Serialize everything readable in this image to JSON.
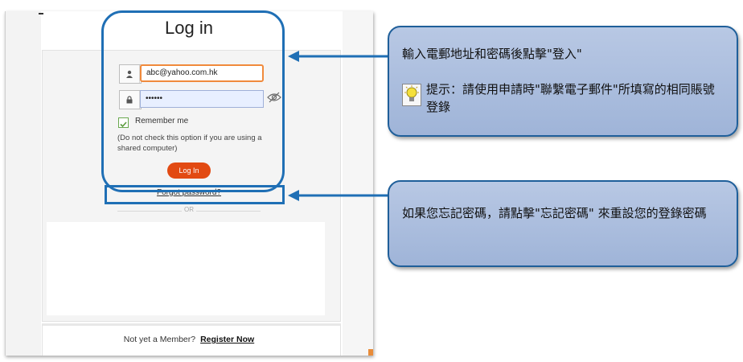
{
  "login": {
    "title": "Log in",
    "email_value": "abc@yahoo.com.hk",
    "password_value": "••••••",
    "remember_label": "Remember me",
    "remember_checked": true,
    "remember_note": "(Do not check this option if you are using a shared computer)",
    "login_button": "Log In",
    "forgot_link": "Forgot password?",
    "or_text": "OR",
    "member_text": "Not yet a Member?",
    "register_link": "Register Now"
  },
  "callouts": {
    "instruction": "輸入電郵地址和密碼後點擊\"登入\"",
    "hint": "提示：請使用申請時\"聯繫電子郵件\"所填寫的相同賬號登錄",
    "forgot_help": "如果您忘記密碼，請點擊\"忘記密碼\" 來重設您的登錄密碼"
  },
  "colors": {
    "accent_blue": "#1f6fb5",
    "login_button": "#e24a12",
    "input_focus": "#f08a3c",
    "callout_fill": "#a9bcdc"
  },
  "icons": [
    "user-icon",
    "lock-icon",
    "eye-slash-icon",
    "check-icon",
    "lightbulb-icon"
  ]
}
